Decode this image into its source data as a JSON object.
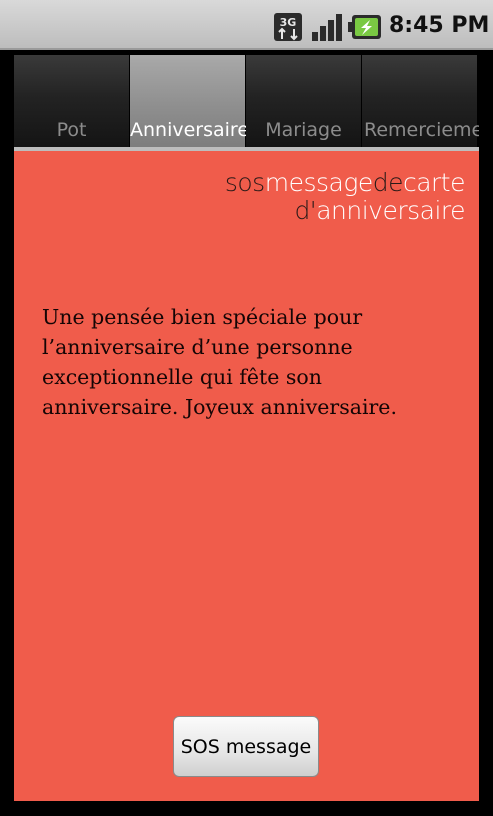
{
  "status_bar": {
    "network_type": "3G",
    "time": "8:45 PM",
    "icons": [
      "3g-data-icon",
      "signal-strength-icon",
      "battery-charging-icon"
    ]
  },
  "tabs": [
    {
      "label": "Pot",
      "selected": false
    },
    {
      "label": "Anniversaire",
      "selected": true
    },
    {
      "label": "Mariage",
      "selected": false
    },
    {
      "label": "Remerciement",
      "selected": false
    }
  ],
  "brand": {
    "line1_part1": "sos",
    "line1_part2": "message",
    "line1_part3": "de",
    "line1_part4": "carte",
    "line2_part1": "d'",
    "line2_part2": "anniversaire"
  },
  "message": {
    "text": "Une pensée bien spéciale pour l’anniversaire d’une personne exceptionnelle qui fête son anniversaire. Joyeux anniversaire."
  },
  "action": {
    "button_label": "SOS message"
  },
  "colors": {
    "content_background": "#f05c4b",
    "selected_tab": "#8f8f8f",
    "unselected_tab": "#1f1f1f",
    "brand_dark": "#2a1a18",
    "brand_light": "#ffffff"
  }
}
